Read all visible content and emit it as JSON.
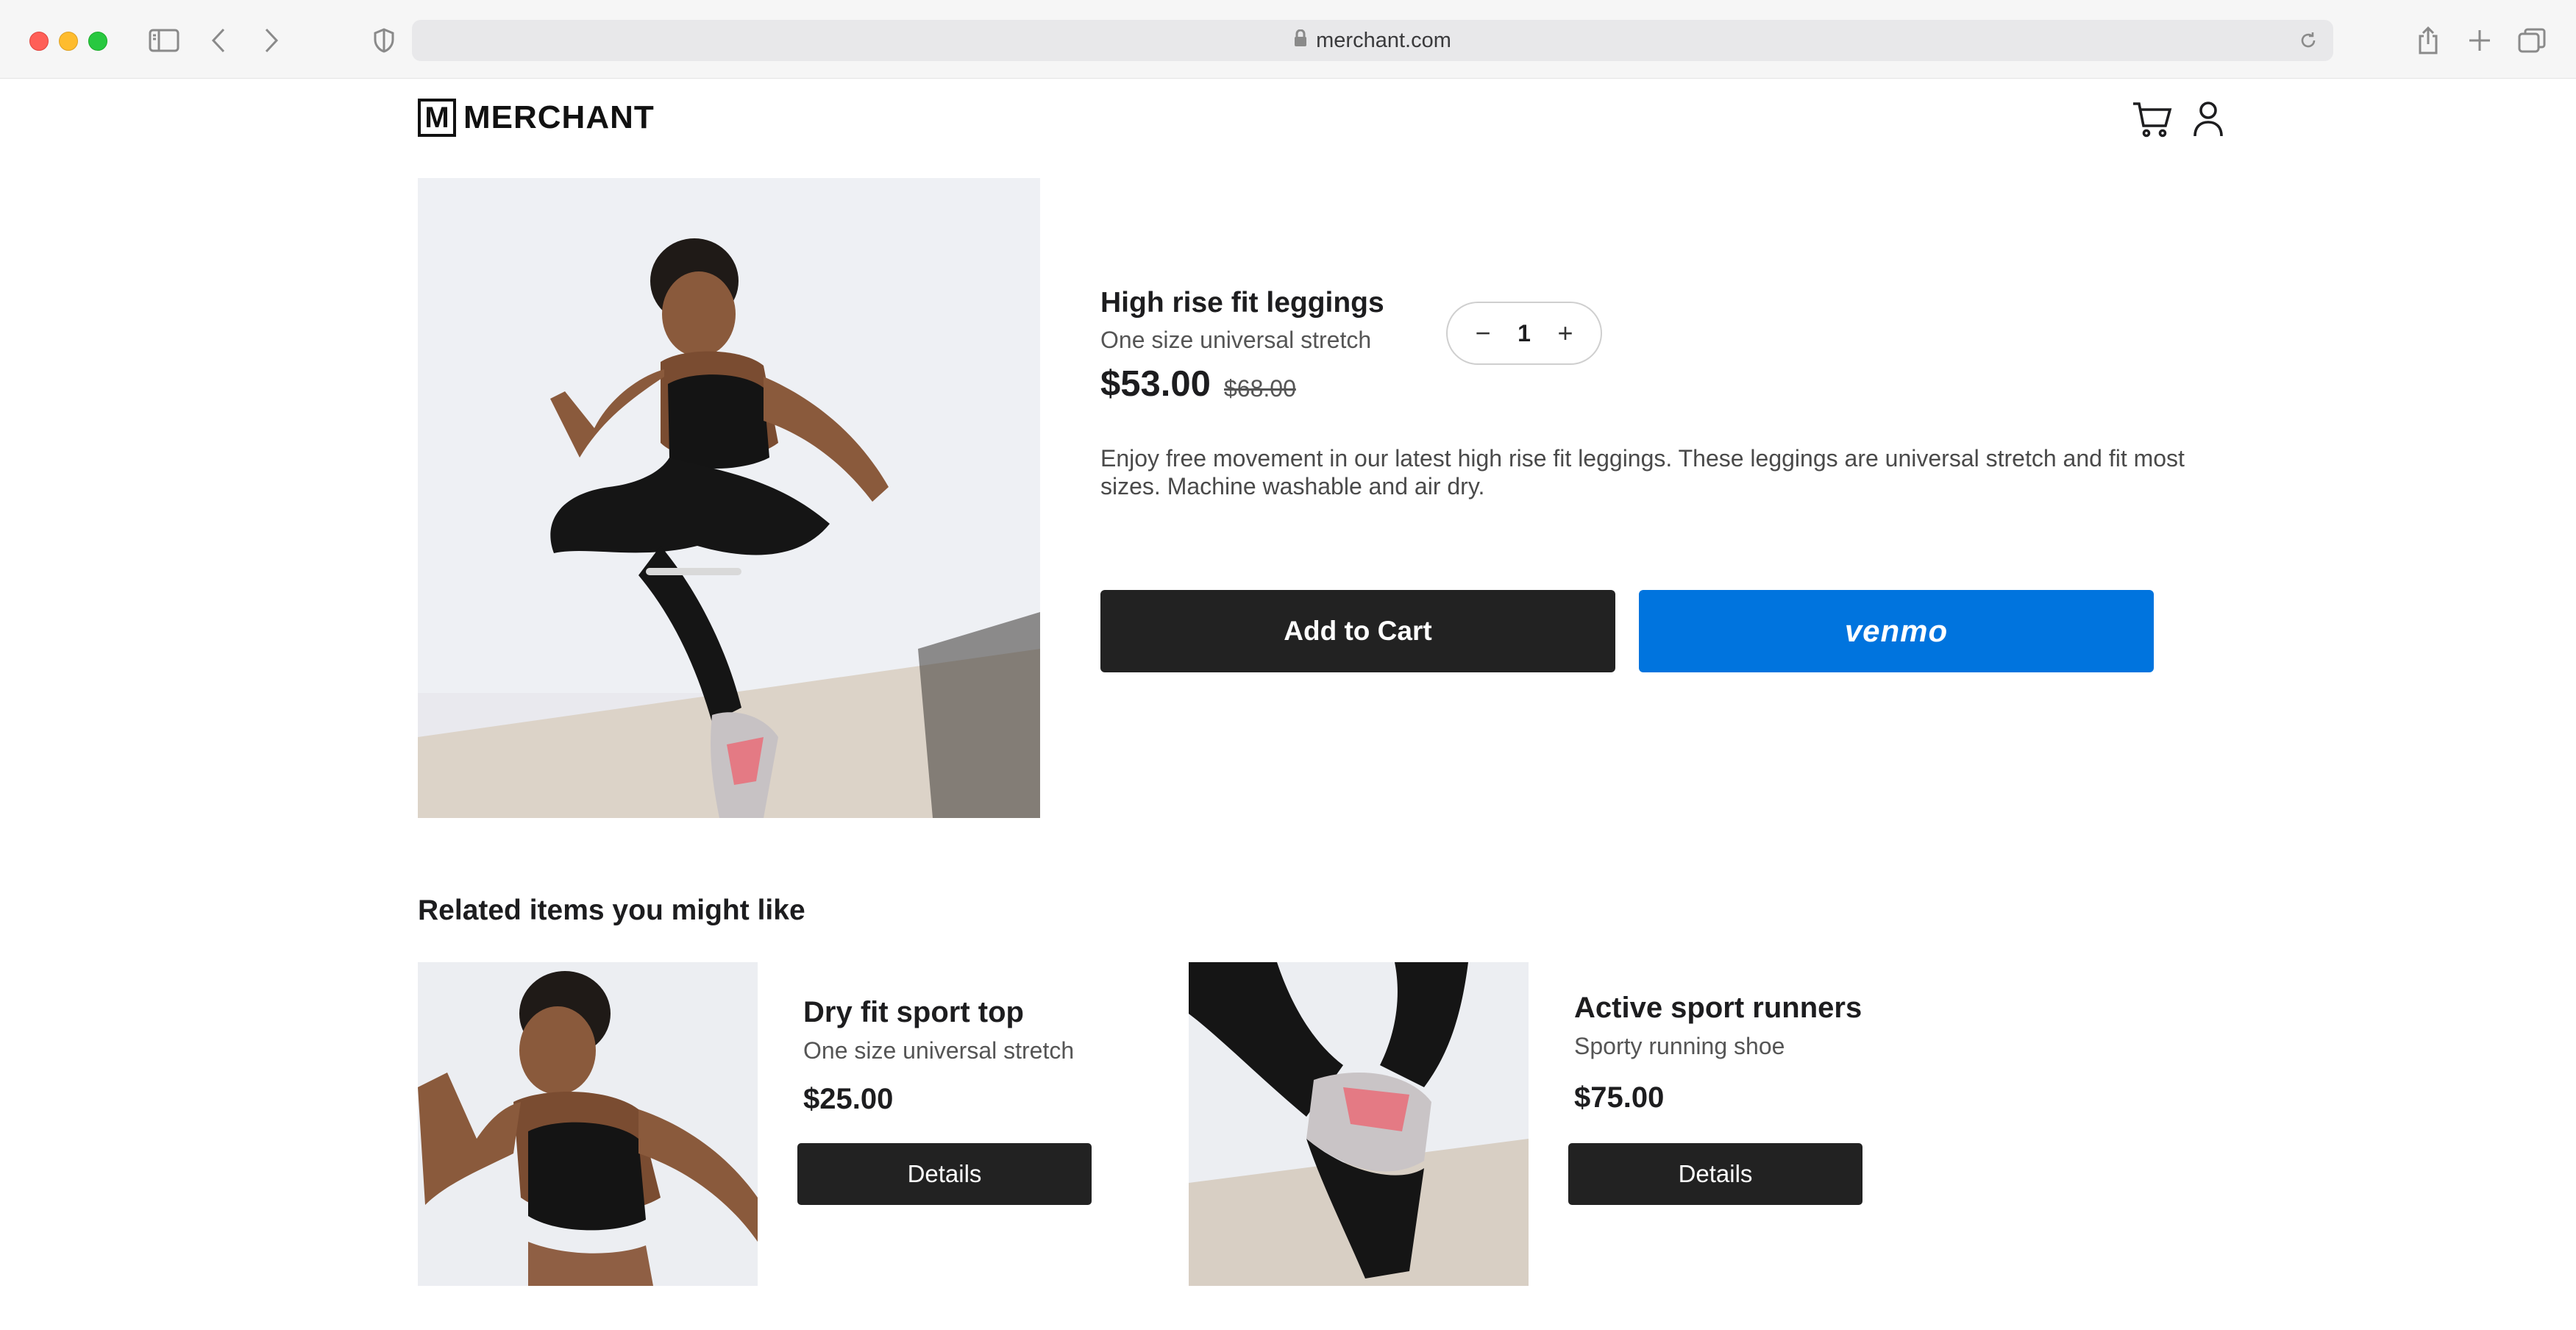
{
  "browser": {
    "url": "merchant.com"
  },
  "header": {
    "logo_mark": "M",
    "logo_text": "MERCHANT"
  },
  "product": {
    "title": "High rise fit leggings",
    "subtitle": "One size universal stretch",
    "price": "$53.00",
    "original_price": "$68.00",
    "quantity": "1",
    "description": "Enjoy free movement in our latest high rise fit leggings. These leggings are universal stretch and fit most sizes. Machine washable and air dry.",
    "add_to_cart_label": "Add to Cart",
    "venmo_label": "venmo"
  },
  "related": {
    "heading": "Related items you might like",
    "items": [
      {
        "name": "Dry fit sport top",
        "subtitle": "One size universal stretch",
        "price": "$25.00",
        "button_label": "Details"
      },
      {
        "name": "Active sport runners",
        "subtitle": "Sporty running shoe",
        "price": "$75.00",
        "button_label": "Details"
      }
    ]
  },
  "colors": {
    "primary_button": "#222222",
    "venmo_blue": "#0074de",
    "text": "#1d1d1f",
    "muted_text": "#555555"
  },
  "icons": {
    "cart": "cart-icon",
    "account": "user-icon",
    "lock": "lock-icon",
    "reload": "reload-icon"
  }
}
